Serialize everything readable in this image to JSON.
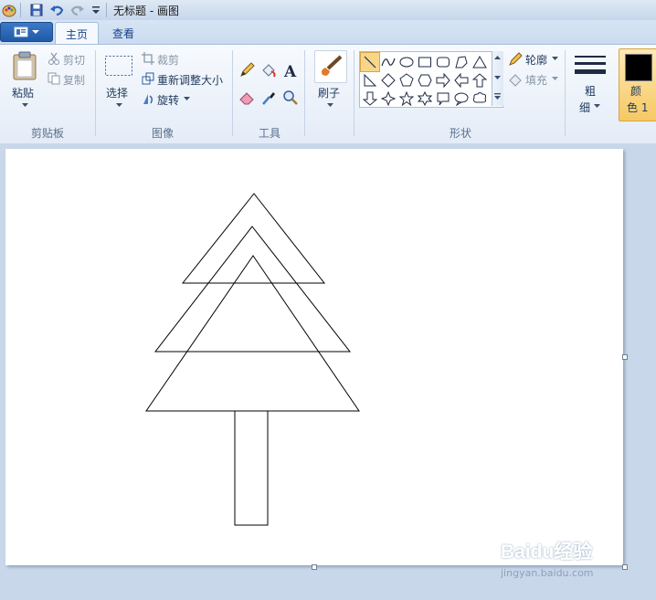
{
  "window": {
    "title": "无标题 - 画图",
    "tabs": [
      {
        "label": "主页"
      },
      {
        "label": "查看"
      }
    ]
  },
  "quick_access": {
    "icons": [
      "paint-app-icon",
      "save-icon",
      "undo-icon",
      "redo-icon",
      "customize-dropdown-icon"
    ]
  },
  "ribbon": {
    "clipboard": {
      "group_label": "剪贴板",
      "paste_label": "粘贴",
      "cut_label": "剪切",
      "copy_label": "复制"
    },
    "image": {
      "group_label": "图像",
      "select_label": "选择",
      "crop_label": "裁剪",
      "resize_label": "重新调整大小",
      "rotate_label": "旋转"
    },
    "tools": {
      "group_label": "工具",
      "items": [
        "pencil-icon",
        "fill-bucket-icon",
        "text-icon",
        "eraser-icon",
        "color-picker-icon",
        "magnifier-icon"
      ]
    },
    "brushes": {
      "label": "刷子"
    },
    "shapes": {
      "group_label": "形状",
      "outline_label": "轮廓",
      "fill_label": "填充",
      "gallery": [
        "line",
        "curve",
        "oval",
        "rectangle",
        "rounded-rectangle",
        "polygon",
        "triangle",
        "right-triangle",
        "diamond",
        "pentagon",
        "hexagon",
        "right-arrow",
        "left-arrow",
        "up-arrow",
        "down-arrow",
        "four-point-star",
        "five-point-star",
        "six-point-star",
        "rounded-callout",
        "oval-callout",
        "cloud-callout"
      ],
      "selected": "line"
    },
    "size": {
      "label_line1": "粗",
      "label_line2": "细"
    },
    "color1": {
      "label_line1": "颜",
      "label_line2": "色 1",
      "value": "#000000"
    }
  },
  "watermark": {
    "brand": "Baidu经验",
    "url": "jingyan.baidu.com"
  },
  "colors": {
    "accent": "#f6c864",
    "selected_shape": "#f7d68a"
  }
}
